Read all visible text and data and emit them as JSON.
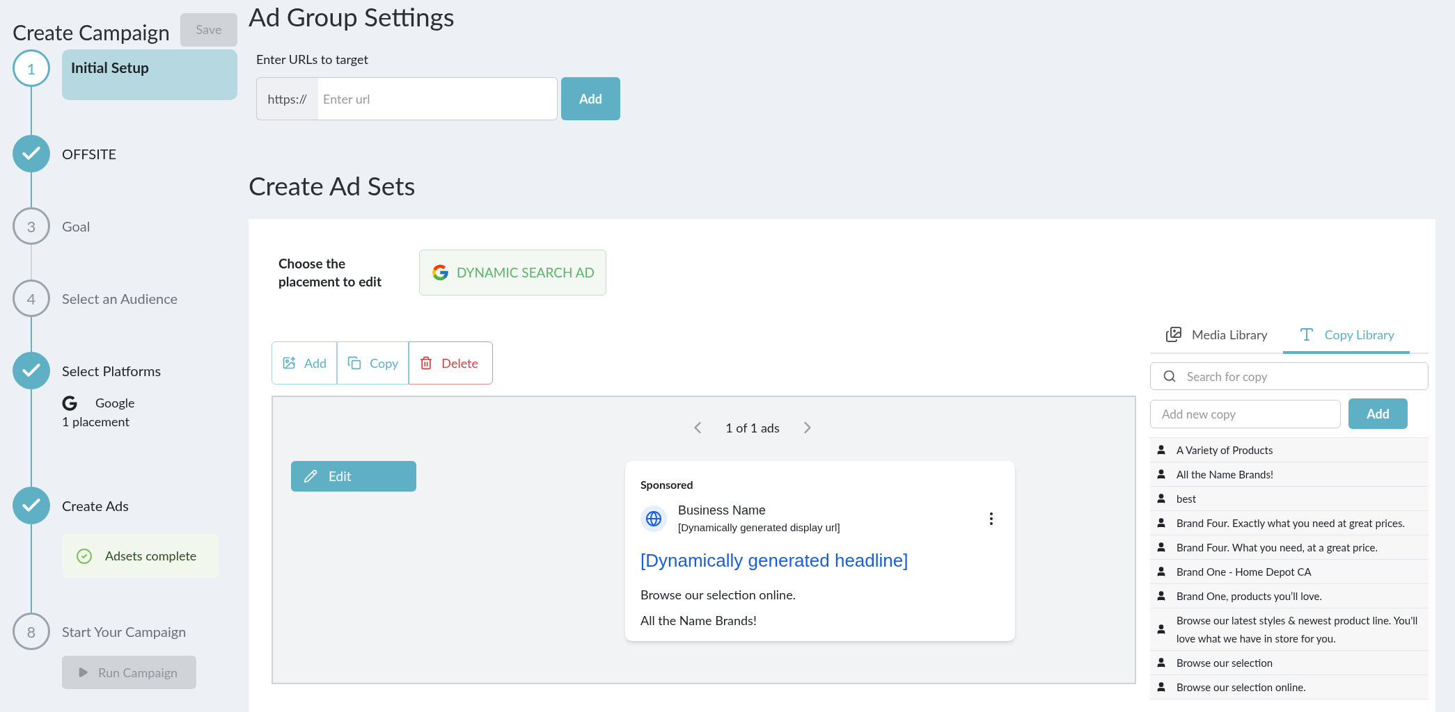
{
  "sidebar": {
    "title": "Create Campaign",
    "save_button": {
      "label": "Save",
      "disabled": true
    },
    "steps": [
      {
        "kind": "current",
        "number": "1",
        "label": "Initial Setup"
      },
      {
        "kind": "done",
        "label": "OFFSITE"
      },
      {
        "kind": "todo",
        "number": "3",
        "label": "Goal"
      },
      {
        "kind": "todo",
        "number": "4",
        "label": "Select an Audience"
      },
      {
        "kind": "done",
        "label": "Select Platforms",
        "platform": "Google",
        "detail": "1 placement"
      },
      {
        "kind": "done",
        "label": "Create Ads",
        "status": "Adsets complete"
      },
      {
        "kind": "todo",
        "number": "8",
        "label": "Start Your Campaign",
        "button": {
          "label": "Run Campaign",
          "disabled": true
        }
      }
    ]
  },
  "ad_group_settings": {
    "title": "Ad Group Settings",
    "url_label": "Enter URLs to target",
    "prefix": "https://",
    "placeholder": "Enter url",
    "add_button": "Add"
  },
  "ad_sets": {
    "title": "Create Ad Sets",
    "placement_label": "Choose the placement to edit",
    "placement": "DYNAMIC SEARCH AD",
    "toolbar": [
      {
        "kind": "add",
        "label": "Add"
      },
      {
        "kind": "copy",
        "label": "Copy"
      },
      {
        "kind": "delete",
        "label": "Delete"
      }
    ],
    "pager": "1 of 1 ads",
    "edit_button": "Edit",
    "ad": {
      "sponsored": "Sponsored",
      "business": "Business Name",
      "display_url": "[Dynamically generated display url]",
      "headline": "[Dynamically generated headline]",
      "lines": [
        "Browse our selection online.",
        "All the Name Brands!"
      ]
    }
  },
  "library": {
    "tabs": [
      {
        "kind": "media",
        "label": "Media Library",
        "selected": false
      },
      {
        "kind": "copy",
        "label": "Copy Library",
        "selected": true
      }
    ],
    "search_placeholder": "Search for copy",
    "new_placeholder": "Add new copy",
    "add_button": "Add",
    "items": [
      "A Variety of Products",
      "All the Name Brands!",
      "best",
      "Brand Four. Exactly what you need at great prices.",
      "Brand Four. What you need, at a great price.",
      "Brand One - Home Depot CA",
      "Brand One, products you’ll love.",
      "Browse our latest styles & newest product line. You'll love what we have in store for you.",
      "Browse our selection",
      "Browse our selection online."
    ]
  }
}
